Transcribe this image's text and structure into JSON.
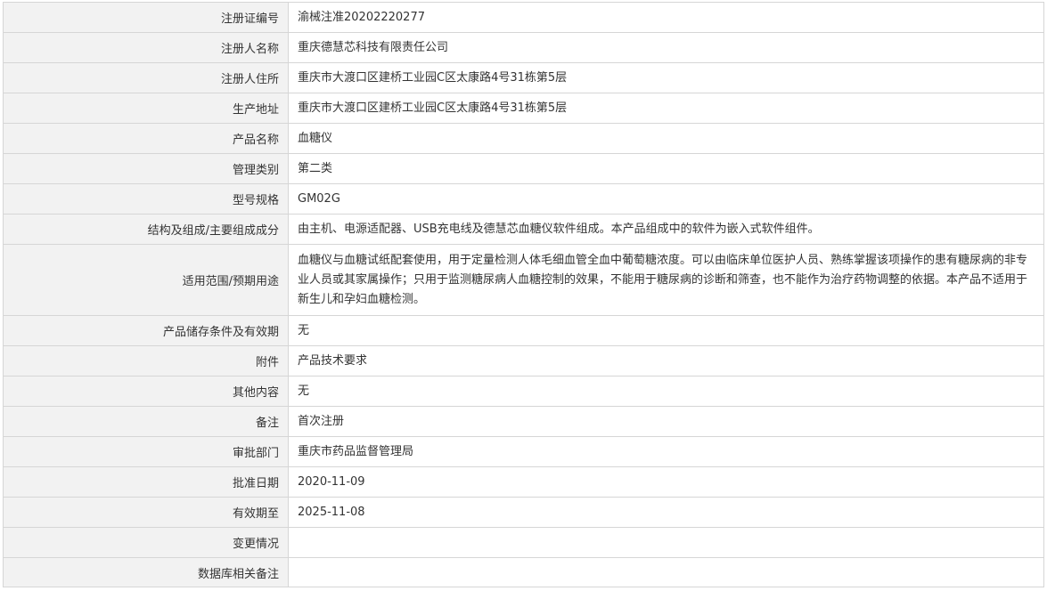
{
  "rows": [
    {
      "label": "注册证编号",
      "value": "渝械注准20202220277"
    },
    {
      "label": "注册人名称",
      "value": "重庆德慧芯科技有限责任公司"
    },
    {
      "label": "注册人住所",
      "value": "重庆市大渡口区建桥工业园C区太康路4号31栋第5层"
    },
    {
      "label": "生产地址",
      "value": "重庆市大渡口区建桥工业园C区太康路4号31栋第5层"
    },
    {
      "label": "产品名称",
      "value": "血糖仪"
    },
    {
      "label": "管理类别",
      "value": "第二类"
    },
    {
      "label": "型号规格",
      "value": "GM02G"
    },
    {
      "label": "结构及组成/主要组成成分",
      "value": "由主机、电源适配器、USB充电线及德慧芯血糖仪软件组成。本产品组成中的软件为嵌入式软件组件。"
    },
    {
      "label": "适用范围/预期用途",
      "value": "血糖仪与血糖试纸配套使用，用于定量检测人体毛细血管全血中葡萄糖浓度。可以由临床单位医护人员、熟练掌握该项操作的患有糖尿病的非专业人员或其家属操作；只用于监测糖尿病人血糖控制的效果，不能用于糖尿病的诊断和筛查，也不能作为治疗药物调整的依据。本产品不适用于新生儿和孕妇血糖检测。"
    },
    {
      "label": "产品储存条件及有效期",
      "value": "无"
    },
    {
      "label": "附件",
      "value": "产品技术要求"
    },
    {
      "label": "其他内容",
      "value": "无"
    },
    {
      "label": "备注",
      "value": "首次注册"
    },
    {
      "label": "审批部门",
      "value": "重庆市药品监督管理局"
    },
    {
      "label": "批准日期",
      "value": "2020-11-09"
    },
    {
      "label": "有效期至",
      "value": "2025-11-08"
    },
    {
      "label": "变更情况",
      "value": ""
    },
    {
      "label": "数据库相关备注",
      "value": ""
    }
  ]
}
